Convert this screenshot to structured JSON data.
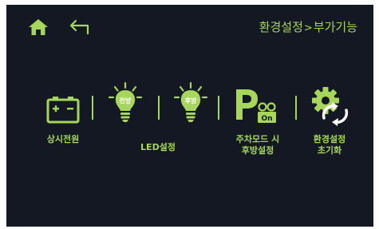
{
  "header": {
    "breadcrumb_parent": "환경설정",
    "breadcrumb_separator": ">",
    "breadcrumb_current": "부가기능"
  },
  "icons": {
    "home": "home-icon",
    "back": "back-arrow-icon"
  },
  "menu": {
    "items": [
      {
        "label": "상시전원",
        "icon": "battery-icon"
      },
      {
        "label": "LED설정",
        "icon": "bulb-icon"
      },
      {
        "label_line1": "주차모드 시",
        "label_line2": "후방설정",
        "icon": "parking-camera-icon",
        "badge": "On"
      },
      {
        "label_line1": "환경설정",
        "label_line2": "초기화",
        "icon": "gear-reset-icon"
      }
    ],
    "bulbs": [
      {
        "text": "전방"
      },
      {
        "text": "후방"
      }
    ]
  },
  "colors": {
    "accent": "#a6d65a",
    "background": "#131822"
  }
}
